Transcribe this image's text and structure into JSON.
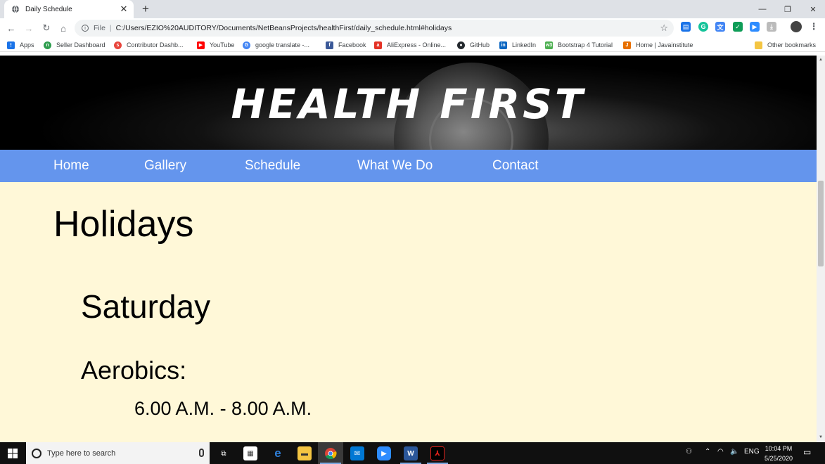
{
  "browser": {
    "tab_title": "Daily Schedule",
    "url_scheme": "File",
    "url": "C:/Users/EZIO%20AUDITORY/Documents/NetBeansProjects/healthFirst/daily_schedule.html#holidays",
    "bookmarks": [
      {
        "label": "Apps",
        "icon": "apps-grid-icon",
        "color": "#1a73e8"
      },
      {
        "label": "Seller Dashboard",
        "icon": "seller-icon",
        "color": "#2e9d4e"
      },
      {
        "label": "Contributor Dashb...",
        "icon": "contributor-icon",
        "color": "#e8453c"
      },
      {
        "label": "YouTube",
        "icon": "youtube-icon",
        "color": "#ff0000"
      },
      {
        "label": "google translate -...",
        "icon": "google-icon",
        "color": "#4285f4"
      },
      {
        "label": "Facebook",
        "icon": "facebook-icon",
        "color": "#3b5998"
      },
      {
        "label": "AliExpress - Online...",
        "icon": "aliexpress-icon",
        "color": "#e43225"
      },
      {
        "label": "GitHub",
        "icon": "github-icon",
        "color": "#24292e"
      },
      {
        "label": "LinkedIn",
        "icon": "linkedin-icon",
        "color": "#0a66c2"
      },
      {
        "label": "Bootstrap 4 Tutorial",
        "icon": "w3schools-icon",
        "color": "#4caf50"
      },
      {
        "label": "Home | Javainstitute",
        "icon": "java-icon",
        "color": "#e76f00"
      }
    ],
    "other_bookmarks": "Other bookmarks"
  },
  "site": {
    "brand": "HEALTH FIRST",
    "menu": [
      "Home",
      "Gallery",
      "Schedule",
      "What We Do",
      "Contact"
    ],
    "accent": "#6495ed",
    "background": "#fff8d8"
  },
  "content": {
    "section_title": "Holidays",
    "day": "Saturday",
    "activity": "Aerobics:",
    "time": "6.00 A.M. - 8.00 A.M."
  },
  "taskbar": {
    "search_placeholder": "Type here to search",
    "language": "ENG",
    "time": "10:04 PM",
    "date": "5/25/2020"
  }
}
